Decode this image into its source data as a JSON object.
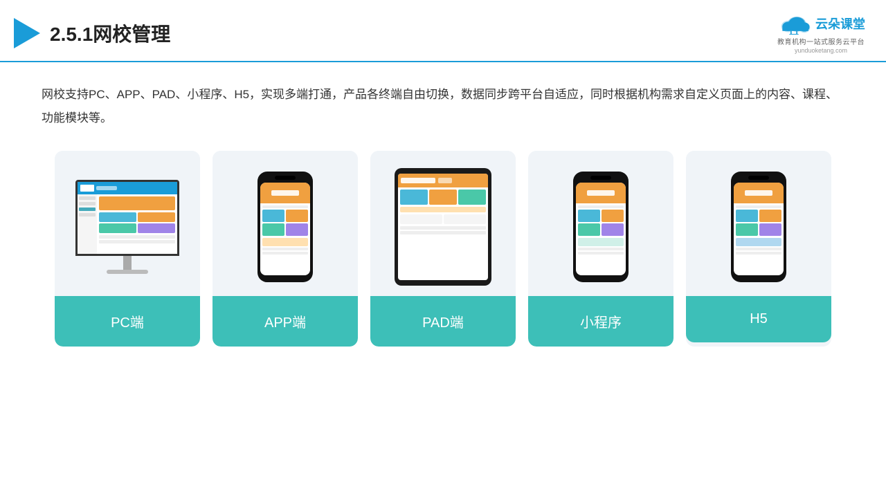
{
  "header": {
    "title": "2.5.1网校管理",
    "logo_name": "云朵课堂",
    "logo_url": "yunduoketang.com",
    "logo_tagline": "教育机构一站式服务云平台"
  },
  "description": "网校支持PC、APP、PAD、小程序、H5，实现多端打通，产品各终端自由切换，数据同步跨平台自适应，同时根据机构需求自定义页面上的内容、课程、功能模块等。",
  "cards": [
    {
      "label": "PC端",
      "device": "monitor"
    },
    {
      "label": "APP端",
      "device": "phone"
    },
    {
      "label": "PAD端",
      "device": "tablet"
    },
    {
      "label": "小程序",
      "device": "phone"
    },
    {
      "label": "H5",
      "device": "phone"
    }
  ],
  "accent_color": "#3dbfb8"
}
